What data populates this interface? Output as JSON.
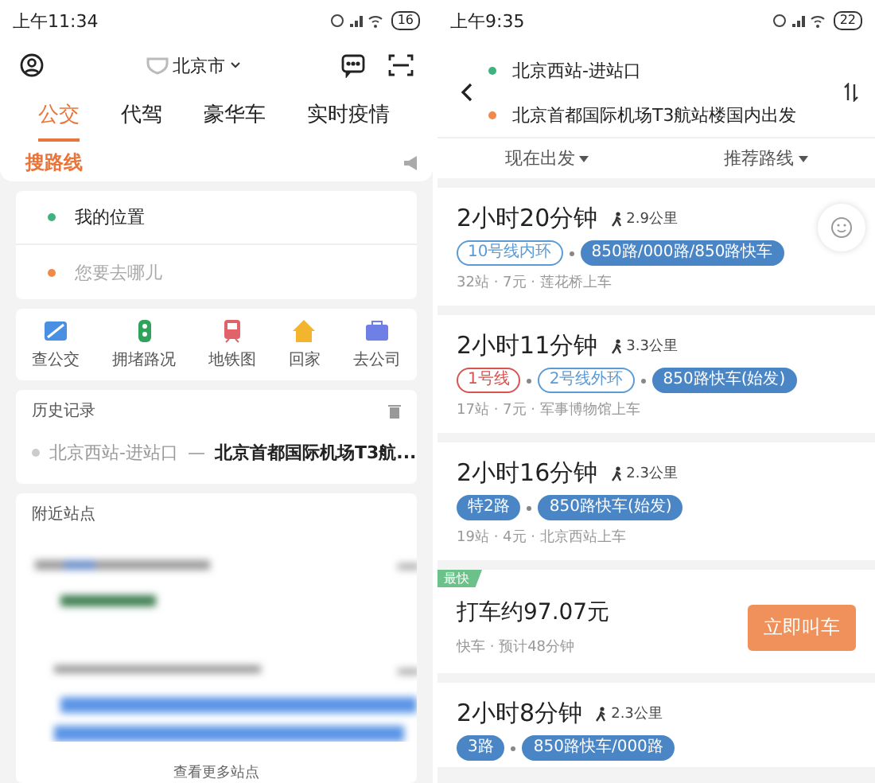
{
  "left": {
    "status_bar": {
      "time": "上午11:34",
      "battery": "16"
    },
    "header": {
      "city": "北京市"
    },
    "tabs": [
      {
        "label": "公交",
        "selected": true
      },
      {
        "label": "代驾",
        "selected": false
      },
      {
        "label": "豪华车",
        "selected": false
      },
      {
        "label": "实时疫情",
        "selected": false
      }
    ],
    "section_title": "搜路线",
    "inputs": [
      {
        "kind": "origin",
        "value": "我的位置"
      },
      {
        "kind": "destination",
        "placeholder": "您要去哪儿"
      }
    ],
    "shortcuts": [
      {
        "kind": "map",
        "label": "查公交",
        "color": "#4a90e2"
      },
      {
        "kind": "traffic",
        "label": "拥堵路况",
        "color": "#2fa35a"
      },
      {
        "kind": "metro",
        "label": "地铁图",
        "color": "#e0626a"
      },
      {
        "kind": "home",
        "label": "回家",
        "color": "#f2b52d"
      },
      {
        "kind": "work",
        "label": "去公司",
        "color": "#6e7fe6"
      }
    ],
    "history": {
      "title": "历史记录",
      "items": [
        {
          "from": "北京西站-进站口",
          "arrow": "—",
          "to": "北京首都国际机场T3航..."
        }
      ]
    },
    "nearby": {
      "title": "附近站点",
      "more": "查看更多站点"
    }
  },
  "right": {
    "status_bar": {
      "time": "上午9:35",
      "battery": "22"
    },
    "origin": "北京西站-进站口",
    "destination": "北京首都国际机场T3航站楼国内出发",
    "filters": [
      {
        "label": "现在出发"
      },
      {
        "label": "推荐路线"
      }
    ],
    "routes": [
      {
        "kind": "transit",
        "duration": "2小时20分钟",
        "walk": "2.9公里",
        "tags": [
          {
            "label": "10号线内环",
            "kind": "line",
            "color": "#5b9bd5"
          },
          {
            "label": "850路/000路/850路快车",
            "kind": "bus",
            "color": "#4a86c5"
          }
        ],
        "info": "32站 · 7元 · 莲花桥上车"
      },
      {
        "kind": "transit",
        "duration": "2小时11分钟",
        "walk": "3.3公里",
        "tags": [
          {
            "label": "1号线",
            "kind": "line",
            "color": "#d9534f"
          },
          {
            "label": "2号线外环",
            "kind": "line",
            "color": "#5b9bd5"
          },
          {
            "label": "850路快车(始发)",
            "kind": "bus",
            "color": "#4a86c5"
          }
        ],
        "info": "17站 · 7元 · 军事博物馆上车"
      },
      {
        "kind": "transit",
        "duration": "2小时16分钟",
        "walk": "2.3公里",
        "tags": [
          {
            "label": "特2路",
            "kind": "bus",
            "color": "#4a86c5"
          },
          {
            "label": "850路快车(始发)",
            "kind": "bus",
            "color": "#4a86c5"
          }
        ],
        "info": "19站 · 4元 · 北京西站上车"
      },
      {
        "kind": "taxi",
        "badge": "最快",
        "price": "打车约97.07元",
        "info": "快车 · 预计48分钟",
        "action": "立即叫车"
      },
      {
        "kind": "transit",
        "duration": "2小时8分钟",
        "walk": "2.3公里",
        "tags": [
          {
            "label": "3路",
            "kind": "bus",
            "color": "#4a86c5"
          },
          {
            "label": "850路快车/000路",
            "kind": "bus",
            "color": "#4a86c5"
          }
        ]
      }
    ]
  }
}
